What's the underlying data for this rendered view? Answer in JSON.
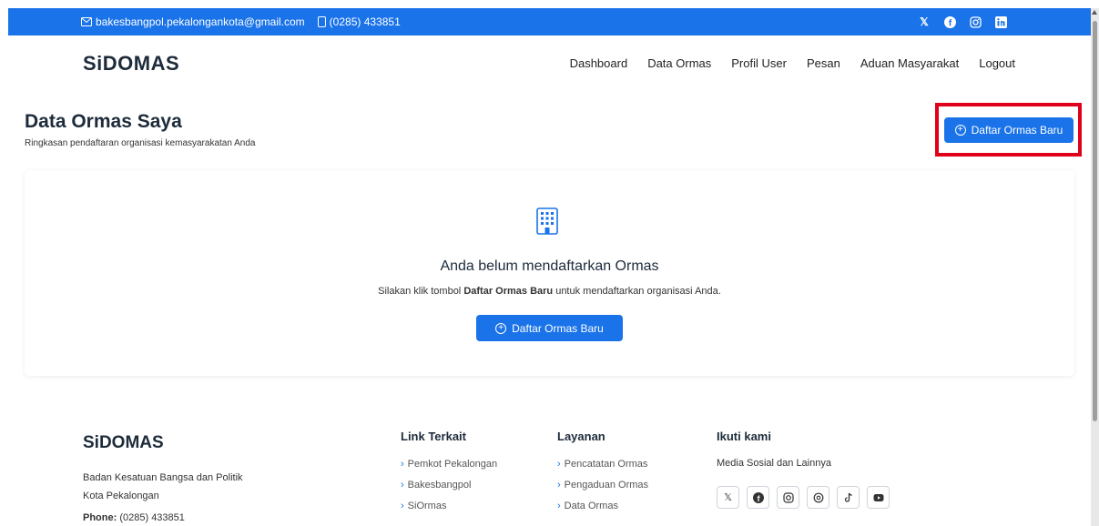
{
  "topbar": {
    "email": "bakesbangpol.pekalongankota@gmail.com",
    "phone": "(0285) 433851",
    "socials": [
      "x-icon",
      "facebook-icon",
      "instagram-icon",
      "linkedin-icon"
    ]
  },
  "header": {
    "logo": "SiDOMAS",
    "nav": [
      "Dashboard",
      "Data Ormas",
      "Profil User",
      "Pesan",
      "Aduan Masyarakat",
      "Logout"
    ]
  },
  "page": {
    "title": "Data Ormas Saya",
    "subtitle": "Ringkasan pendaftaran organisasi kemasyarakatan Anda",
    "primary_button": "Daftar Ormas Baru"
  },
  "empty_state": {
    "title": "Anda belum mendaftarkan Ormas",
    "desc_prefix": "Silakan klik tombol ",
    "desc_bold": "Daftar Ormas Baru",
    "desc_suffix": " untuk mendaftarkan organisasi Anda.",
    "button": "Daftar Ormas Baru"
  },
  "footer": {
    "logo": "SiDOMAS",
    "address_line1": "Badan Kesatuan Bangsa dan Politik",
    "address_line2": "Kota Pekalongan",
    "phone_label": "Phone:",
    "phone_value": " (0285) 433851",
    "links": {
      "title": "Link Terkait",
      "items": [
        "Pemkot Pekalongan",
        "Bakesbangpol",
        "SiOrmas"
      ]
    },
    "services": {
      "title": "Layanan",
      "items": [
        "Pencatatan Ormas",
        "Pengaduan Ormas",
        "Data Ormas"
      ]
    },
    "follow": {
      "title": "Ikuti kami",
      "desc": "Media Sosial dan Lainnya",
      "icons": [
        "x-icon",
        "facebook-icon",
        "instagram-icon",
        "threads-icon",
        "tiktok-icon",
        "youtube-icon"
      ]
    }
  },
  "colors": {
    "primary": "#1a73e8",
    "highlight": "#e0001b",
    "heading": "#1d2b3a"
  }
}
